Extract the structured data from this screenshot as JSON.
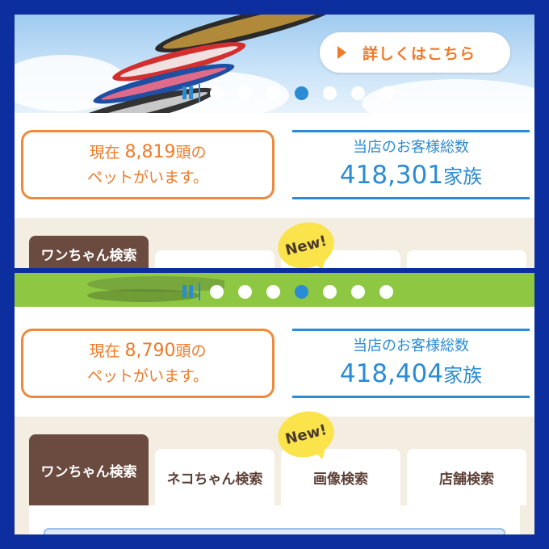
{
  "top": {
    "detail_button": "詳しくはこちら",
    "pet_prefix": "現在",
    "pet_count": "8,819",
    "pet_suffix": "頭の",
    "pet_line2": "ペットがいます。",
    "customers_title": "当店のお客様総数",
    "customers_value": "418,301",
    "customers_unit": "家族",
    "tab_dog": "ワンちゃん検索",
    "new_badge": "New!"
  },
  "bottom": {
    "pet_prefix": "現在",
    "pet_count": "8,790",
    "pet_suffix": "頭の",
    "pet_line2": "ペットがいます。",
    "customers_title": "当店のお客様総数",
    "customers_value": "418,404",
    "customers_unit": "家族",
    "new_badge": "New!",
    "tabs": [
      "ワンちゃん検索",
      "ネコちゃん検索",
      "画像検索",
      "店舗検索"
    ]
  },
  "carousel": {
    "dot_count": 7,
    "active_index": 3
  },
  "colors": {
    "orange": "#ee7b2a",
    "blue": "#2b8bd3",
    "brown": "#6b4a3f",
    "frame": "#0d2e9e",
    "green": "#8ec843"
  },
  "icons": [
    "play-arrow-icon",
    "pause-icon"
  ]
}
